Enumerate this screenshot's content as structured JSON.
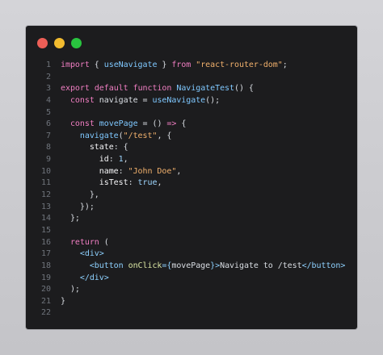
{
  "window": {
    "controls": [
      "close",
      "minimize",
      "maximize"
    ]
  },
  "code": {
    "lines": [
      "1",
      "2",
      "3",
      "4",
      "5",
      "6",
      "7",
      "8",
      "9",
      "10",
      "11",
      "12",
      "13",
      "14",
      "15",
      "16",
      "17",
      "18",
      "19",
      "20",
      "21",
      "22"
    ],
    "text": {
      "l1_a": "import",
      "l1_b": " { ",
      "l1_c": "useNavigate",
      "l1_d": " } ",
      "l1_e": "from",
      "l1_f": " ",
      "l1_g": "\"react-router-dom\"",
      "l1_h": ";",
      "l3_a": "export",
      "l3_b": " ",
      "l3_c": "default",
      "l3_d": " ",
      "l3_e": "function",
      "l3_f": " ",
      "l3_g": "NavigateTest",
      "l3_h": "() {",
      "l4_a": "  ",
      "l4_b": "const",
      "l4_c": " navigate = ",
      "l4_d": "useNavigate",
      "l4_e": "();",
      "l6_a": "  ",
      "l6_b": "const",
      "l6_c": " ",
      "l6_d": "movePage",
      "l6_e": " = () ",
      "l6_f": "=>",
      "l6_g": " {",
      "l7_a": "    ",
      "l7_b": "navigate",
      "l7_c": "(",
      "l7_d": "\"/test\"",
      "l7_e": ", {",
      "l8_a": "      ",
      "l8_b": "state",
      "l8_c": ": {",
      "l9_a": "        ",
      "l9_b": "id",
      "l9_c": ": ",
      "l9_d": "1",
      "l9_e": ",",
      "l10_a": "        ",
      "l10_b": "name",
      "l10_c": ": ",
      "l10_d": "\"John Doe\"",
      "l10_e": ",",
      "l11_a": "        ",
      "l11_b": "isTest",
      "l11_c": ": ",
      "l11_d": "true",
      "l11_e": ",",
      "l12_a": "      },",
      "l13_a": "    });",
      "l14_a": "  };",
      "l16_a": "  ",
      "l16_b": "return",
      "l16_c": " (",
      "l17_a": "    ",
      "l17_b": "<div>",
      "l18_a": "      ",
      "l18_b": "<button",
      "l18_c": " ",
      "l18_d": "onClick",
      "l18_e": "={",
      "l18_f": "movePage",
      "l18_g": "}",
      "l18_h": ">",
      "l18_i": "Navigate to /test",
      "l18_j": "</button>",
      "l19_a": "    ",
      "l19_b": "</div>",
      "l20_a": "  );",
      "l21_a": "}"
    }
  }
}
